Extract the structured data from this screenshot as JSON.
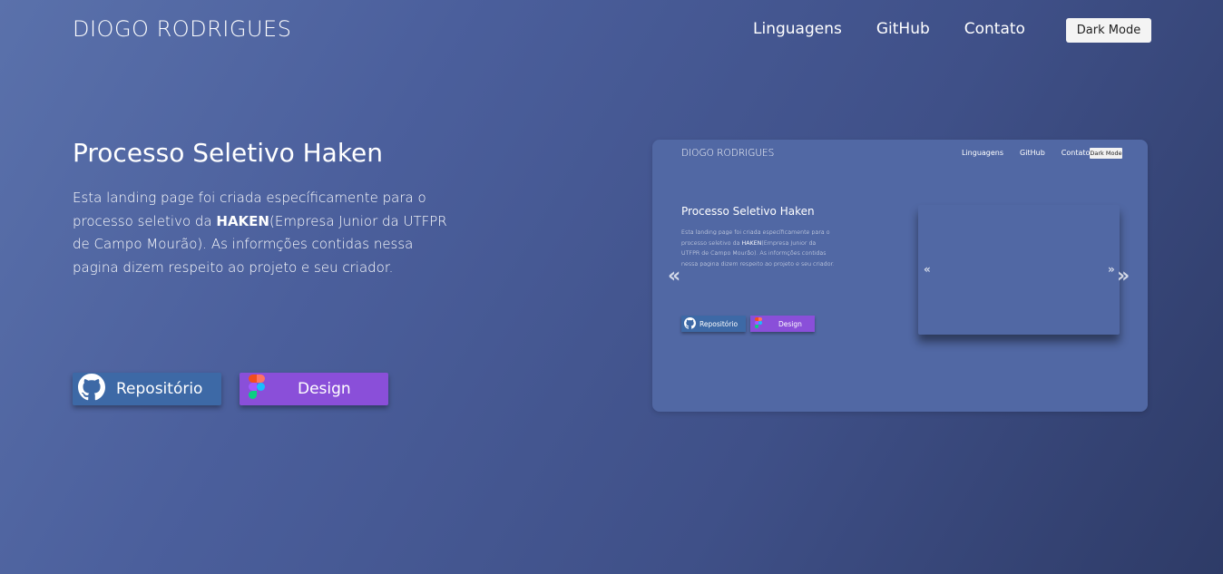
{
  "header": {
    "logo": "DIOGO RODRIGUES",
    "nav": [
      "Linguagens",
      "GitHub",
      "Contato"
    ],
    "dark_mode_label": "Dark Mode"
  },
  "hero": {
    "title": "Processo Seletivo Haken",
    "desc_before": "Esta landing page foi criada específicamente para o processo seletivo da ",
    "desc_bold": "HAKEN",
    "desc_after": "(Empresa Junior da UTFPR de Campo Mourão). As informções contidas nessa pagina dizem respeito ao projeto e seu criador.",
    "repo_label": "Repositório",
    "design_label": "Design"
  },
  "preview": {
    "logo": "DIOGO RODRIGUES",
    "nav": [
      "Linguagens",
      "GitHub",
      "Contato"
    ],
    "dark_mode_label": "Dark Mode",
    "title": "Processo Seletivo Haken",
    "desc_before": "Esta landing page foi criada específicamente para o processo seletivo da ",
    "desc_bold": "HAKEN",
    "desc_after": "(Empresa Junior da UTFPR de Campo Mourão). As informções contidas nessa pagina dizem respeito ao projeto e seu criador.",
    "repo_label": "Repositório",
    "design_label": "Design",
    "chevron_left_big": "«",
    "chevron_right_big": "»",
    "chevron_left_small": "«",
    "chevron_right_small": "»"
  },
  "colors": {
    "bg_start": "#5a71ab",
    "bg_end": "#2e3b67",
    "repo_button": "#3d69a6",
    "design_button": "#8a4fd9"
  }
}
